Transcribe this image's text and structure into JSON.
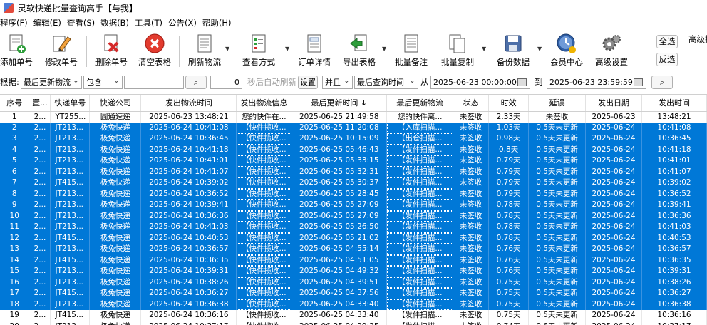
{
  "window": {
    "title": "灵软快递批量查询高手【与我】"
  },
  "menu": [
    "程序(F)",
    "编辑(E)",
    "查看(S)",
    "数据(B)",
    "工具(T)",
    "公告(X)",
    "帮助(H)"
  ],
  "toolbar": {
    "add": "添加单号",
    "edit": "修改单号",
    "delete": "删除单号",
    "clear": "清空表格",
    "refresh": "刷新物流",
    "view_mode": "查看方式",
    "order_detail": "订单详情",
    "export": "导出表格",
    "batch_note": "批量备注",
    "batch_copy": "批量复制",
    "backup": "备份数据",
    "member": "会员中心",
    "advanced": "高级设置",
    "select_all": "全选",
    "invert": "反选",
    "advanced_search": "高级搜"
  },
  "filter": {
    "by_label": "根据:",
    "field": "最后更新物流",
    "match": "包含",
    "keyword": "",
    "seconds": "0",
    "auto_refresh": "秒后自动刷新",
    "settings": "设置",
    "logic": "并且",
    "time_field": "最后查询时间",
    "from_label": "从",
    "from": "2025-06-23 00:00:00",
    "to_label": "到",
    "to": "2025-06-23 23:59:59"
  },
  "table": {
    "headers": [
      "序号",
      "置...",
      "快递单号",
      "快递公司",
      "发出物流时间",
      "发出物流信息",
      "最后更新时间 ↓",
      "最后更新物流",
      "状态",
      "时效",
      "延误",
      "发出日期",
      "发出时间"
    ],
    "rows": [
      {
        "sel": false,
        "cells": [
          "1",
          "2...",
          "YT255...",
          "圆通速递",
          "2025-06-23 13:48:21",
          "您的快件在...",
          "2025-06-25 21:49:58",
          "您的快件离...",
          "未签收",
          "2.33天",
          "未签收",
          "2025-06-23",
          "13:48:21"
        ]
      },
      {
        "sel": true,
        "cells": [
          "2",
          "2...",
          "JT213...",
          "极兔快递",
          "2025-06-24 10:41:08",
          "【快件揽收...",
          "2025-06-25 11:20:08",
          "【入库扫描...",
          "未签收",
          "1.03天",
          "0.5天未更新",
          "2025-06-24",
          "10:41:08"
        ]
      },
      {
        "sel": true,
        "cells": [
          "3",
          "2...",
          "JT213...",
          "极兔快递",
          "2025-06-24 10:36:45",
          "【快件揽收...",
          "2025-06-25 10:15:09",
          "【出仓扫描...",
          "未签收",
          "0.98天",
          "0.5天未更新",
          "2025-06-24",
          "10:36:45"
        ]
      },
      {
        "sel": true,
        "cells": [
          "4",
          "2...",
          "JT213...",
          "极兔快递",
          "2025-06-24 10:41:18",
          "【快件揽收...",
          "2025-06-25 05:46:43",
          "【发件扫描...",
          "未签收",
          "0.8天",
          "0.5天未更新",
          "2025-06-24",
          "10:41:18"
        ]
      },
      {
        "sel": true,
        "cells": [
          "5",
          "2...",
          "JT213...",
          "极兔快递",
          "2025-06-24 10:41:01",
          "【快件揽收...",
          "2025-06-25 05:33:15",
          "【发件扫描...",
          "未签收",
          "0.79天",
          "0.5天未更新",
          "2025-06-24",
          "10:41:01"
        ]
      },
      {
        "sel": true,
        "cells": [
          "6",
          "2...",
          "JT213...",
          "极兔快递",
          "2025-06-24 10:41:07",
          "【快件揽收...",
          "2025-06-25 05:32:31",
          "【发件扫描...",
          "未签收",
          "0.79天",
          "0.5天未更新",
          "2025-06-24",
          "10:41:07"
        ]
      },
      {
        "sel": true,
        "cells": [
          "7",
          "2...",
          "JT415...",
          "极兔快递",
          "2025-06-24 10:39:02",
          "【快件揽收...",
          "2025-06-25 05:30:37",
          "【发件扫描...",
          "未签收",
          "0.79天",
          "0.5天未更新",
          "2025-06-24",
          "10:39:02"
        ]
      },
      {
        "sel": true,
        "cells": [
          "8",
          "2...",
          "JT213...",
          "极兔快递",
          "2025-06-24 10:36:52",
          "【快件揽收...",
          "2025-06-25 05:28:45",
          "【发件扫描...",
          "未签收",
          "0.79天",
          "0.5天未更新",
          "2025-06-24",
          "10:36:52"
        ]
      },
      {
        "sel": true,
        "cells": [
          "9",
          "2...",
          "JT213...",
          "极兔快递",
          "2025-06-24 10:39:41",
          "【快件揽收...",
          "2025-06-25 05:27:09",
          "【发件扫描...",
          "未签收",
          "0.78天",
          "0.5天未更新",
          "2025-06-24",
          "10:39:41"
        ]
      },
      {
        "sel": true,
        "cells": [
          "10",
          "2...",
          "JT213...",
          "极兔快递",
          "2025-06-24 10:36:36",
          "【快件揽收...",
          "2025-06-25 05:27:09",
          "【发件扫描...",
          "未签收",
          "0.78天",
          "0.5天未更新",
          "2025-06-24",
          "10:36:36"
        ]
      },
      {
        "sel": true,
        "cells": [
          "11",
          "2...",
          "JT213...",
          "极兔快递",
          "2025-06-24 10:41:03",
          "【快件揽收...",
          "2025-06-25 05:26:50",
          "【发件扫描...",
          "未签收",
          "0.78天",
          "0.5天未更新",
          "2025-06-24",
          "10:41:03"
        ]
      },
      {
        "sel": true,
        "cells": [
          "12",
          "2...",
          "JT415...",
          "极兔快递",
          "2025-06-24 10:40:53",
          "【快件揽收...",
          "2025-06-25 05:21:02",
          "【发件扫描...",
          "未签收",
          "0.78天",
          "0.5天未更新",
          "2025-06-24",
          "10:40:53"
        ]
      },
      {
        "sel": true,
        "cells": [
          "13",
          "2...",
          "JT213...",
          "极兔快递",
          "2025-06-24 10:36:57",
          "【快件揽收...",
          "2025-06-25 04:55:14",
          "【发件扫描...",
          "未签收",
          "0.76天",
          "0.5天未更新",
          "2025-06-24",
          "10:36:57"
        ]
      },
      {
        "sel": true,
        "cells": [
          "14",
          "2...",
          "JT415...",
          "极兔快递",
          "2025-06-24 10:36:35",
          "【快件揽收...",
          "2025-06-25 04:51:05",
          "【发件扫描...",
          "未签收",
          "0.76天",
          "0.5天未更新",
          "2025-06-24",
          "10:36:35"
        ]
      },
      {
        "sel": true,
        "cells": [
          "15",
          "2...",
          "JT213...",
          "极兔快递",
          "2025-06-24 10:39:31",
          "【快件揽收...",
          "2025-06-25 04:49:32",
          "【发件扫描...",
          "未签收",
          "0.76天",
          "0.5天未更新",
          "2025-06-24",
          "10:39:31"
        ]
      },
      {
        "sel": true,
        "cells": [
          "16",
          "2...",
          "JT213...",
          "极兔快递",
          "2025-06-24 10:38:26",
          "【快件揽收...",
          "2025-06-25 04:39:51",
          "【发件扫描...",
          "未签收",
          "0.75天",
          "0.5天未更新",
          "2025-06-24",
          "10:38:26"
        ]
      },
      {
        "sel": true,
        "cells": [
          "17",
          "2...",
          "JT415...",
          "极兔快递",
          "2025-06-24 10:36:27",
          "【快件揽收...",
          "2025-06-25 04:37:56",
          "【发件扫描...",
          "未签收",
          "0.75天",
          "0.5天未更新",
          "2025-06-24",
          "10:36:27"
        ]
      },
      {
        "sel": true,
        "cells": [
          "18",
          "2...",
          "JT213...",
          "极兔快递",
          "2025-06-24 10:36:38",
          "【快件揽收...",
          "2025-06-25 04:33:40",
          "【发件扫描...",
          "未签收",
          "0.75天",
          "0.5天未更新",
          "2025-06-24",
          "10:36:38"
        ]
      },
      {
        "sel": false,
        "cells": [
          "19",
          "2...",
          "JT415...",
          "极兔快递",
          "2025-06-24 10:36:16",
          "【快件揽收...",
          "2025-06-25 04:33:40",
          "【发件扫描...",
          "未签收",
          "0.75天",
          "0.5天未更新",
          "2025-06-24",
          "10:36:16"
        ]
      },
      {
        "sel": false,
        "cells": [
          "20",
          "2...",
          "JT213...",
          "极兔快递",
          "2025-06-24 10:37:17",
          "【快件揽收...",
          "2025-06-25 04:29:35",
          "【发件扫描...",
          "未签收",
          "0.74天",
          "0.5天未更新",
          "2025-06-24",
          "10:37:17"
        ]
      }
    ]
  },
  "colors": {
    "selection": "#0078d7",
    "text": "#000000",
    "selected_text": "#ffffff"
  },
  "icons": [
    "add-document-icon",
    "pencil-icon",
    "delete-document-icon",
    "clear-x-icon",
    "refresh-document-icon",
    "view-list-icon",
    "detail-document-icon",
    "export-arrow-icon",
    "note-document-icon",
    "copy-document-icon",
    "floppy-disk-icon",
    "clock-user-icon",
    "gear-icon",
    "search-icon",
    "calendar-icon"
  ]
}
